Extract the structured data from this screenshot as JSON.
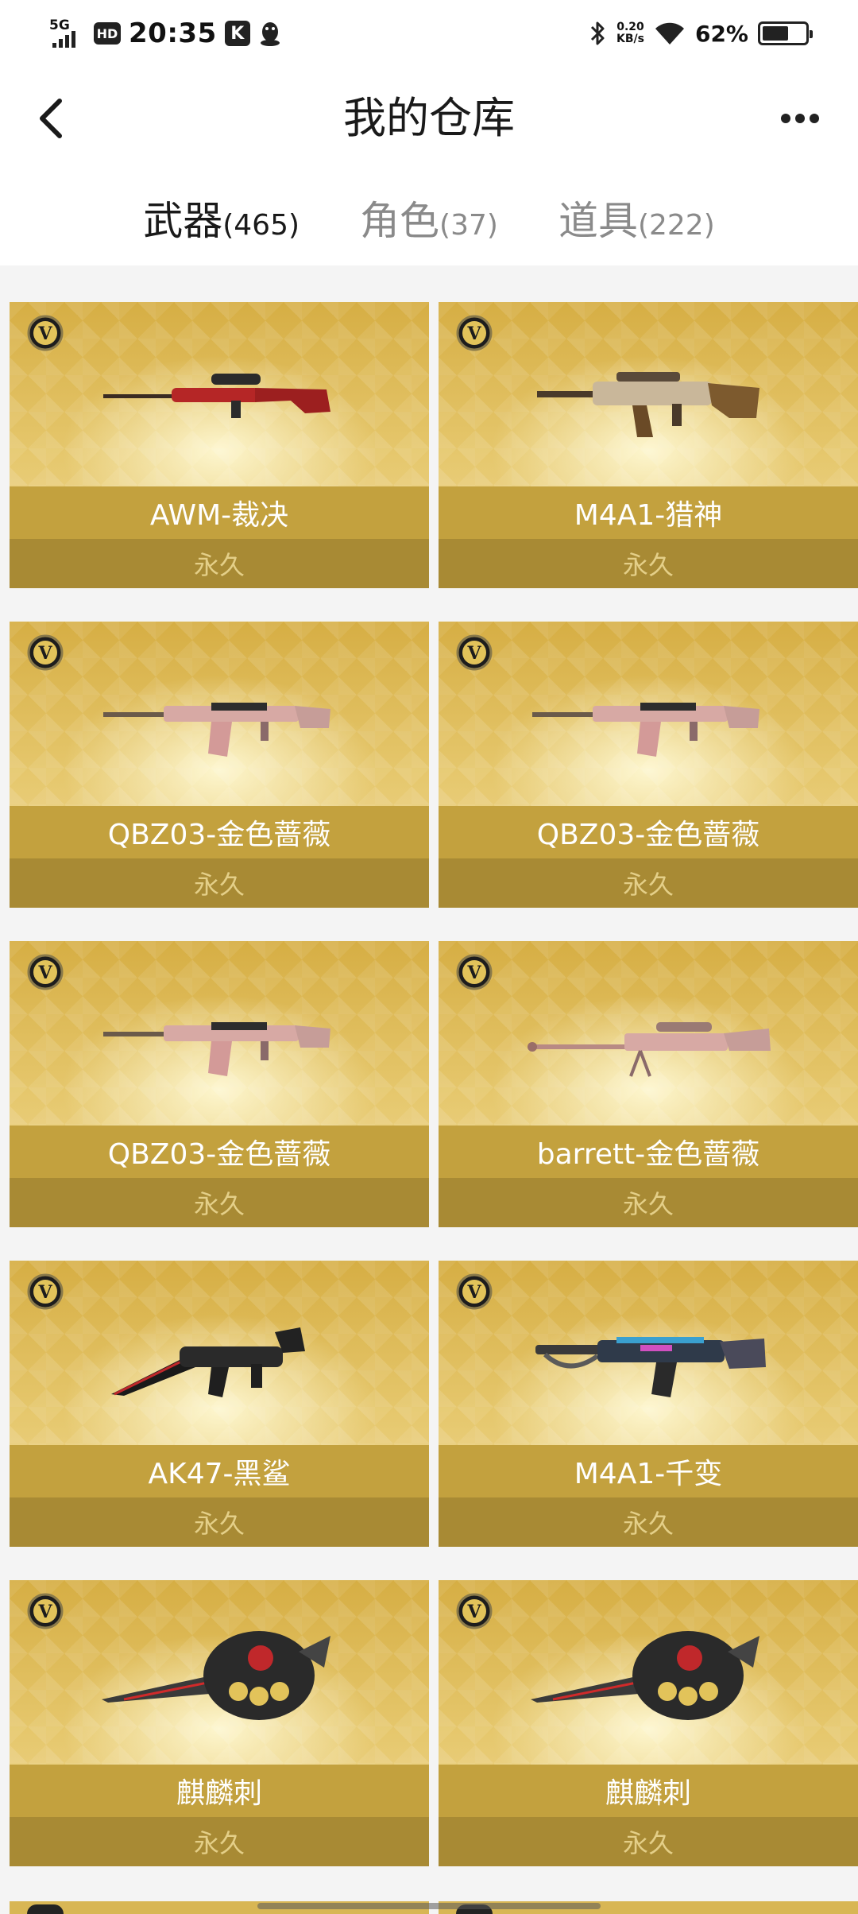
{
  "status_bar": {
    "network": "5G",
    "hd": "HD",
    "time": "20:35",
    "k_badge": "K",
    "speed_value": "0.20",
    "speed_unit": "KB/s",
    "battery": "62%",
    "battery_level": 0.62
  },
  "header": {
    "title": "我的仓库"
  },
  "tabs": [
    {
      "label": "武器",
      "count": "(465)",
      "active": true
    },
    {
      "label": "角色",
      "count": "(37)",
      "active": false
    },
    {
      "label": "道具",
      "count": "(222)",
      "active": false
    }
  ],
  "items": [
    {
      "name": "AWM-裁决",
      "duration": "永久",
      "weapon": "sniper-rifle"
    },
    {
      "name": "M4A1-猎神",
      "duration": "永久",
      "weapon": "assault-rifle"
    },
    {
      "name": "QBZ03-金色蔷薇",
      "duration": "永久",
      "weapon": "assault-rifle"
    },
    {
      "name": "QBZ03-金色蔷薇",
      "duration": "永久",
      "weapon": "assault-rifle"
    },
    {
      "name": "QBZ03-金色蔷薇",
      "duration": "永久",
      "weapon": "assault-rifle"
    },
    {
      "name": "barrett-金色蔷薇",
      "duration": "永久",
      "weapon": "heavy-sniper"
    },
    {
      "name": "AK47-黑鲨",
      "duration": "永久",
      "weapon": "assault-rifle"
    },
    {
      "name": "M4A1-千变",
      "duration": "永久",
      "weapon": "assault-rifle"
    },
    {
      "name": "麒麟刺",
      "duration": "永久",
      "weapon": "knuckle-knife"
    },
    {
      "name": "麒麟刺",
      "duration": "永久",
      "weapon": "knuckle-knife"
    }
  ],
  "colors": {
    "card_gold": "#d6ae44",
    "name_bar": "#c3a13e",
    "duration_bar": "#a88a34",
    "duration_text": "#e4cf88"
  }
}
